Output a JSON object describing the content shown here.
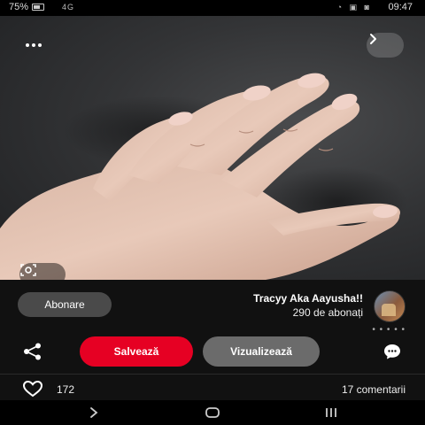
{
  "status_bar": {
    "time": "09:47",
    "battery": "75%",
    "signal": "4G",
    "notifications": "◔ ▣ ◙"
  },
  "pin": {
    "image_subject": "hand-with-nude-manicure",
    "more_icon": "more-dots-icon",
    "back_icon": "chevron-left-icon",
    "lens_icon": "visual-search-icon"
  },
  "creator": {
    "name": "Tracyy Aka Aayusha!!",
    "followers": "290 de abonați",
    "follow_label": "Abonare"
  },
  "dots": "• • • • •",
  "actions": {
    "visit_label": "Vizualizează",
    "save_label": "Salvează",
    "share_icon": "share-icon",
    "comment_icon": "comment-icon"
  },
  "stats": {
    "likes": "172",
    "comments": "17 comentarii",
    "like_icon": "heart-icon"
  },
  "colors": {
    "accent_save": "#e60023",
    "visit_bg": "#6b6b6b",
    "sheet_bg": "#111111"
  }
}
